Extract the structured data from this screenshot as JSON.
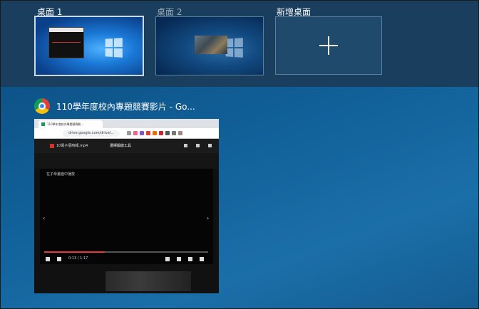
{
  "desktops": [
    {
      "label": "桌面 1",
      "active": true
    },
    {
      "label": "桌面 2",
      "active": false
    }
  ],
  "new_desktop": {
    "label": "新增桌面",
    "icon": "plus-icon"
  },
  "window": {
    "app_icon": "chrome-icon",
    "title": "110學年度校內專題競賽影片 - Go...",
    "thumbnail": {
      "tab_title": "110學年度校內專題競賽影...",
      "address": "drive.google.com/drive/...",
      "file_name": "10電子個時報.mp4",
      "open_with": "選擇開啟工具",
      "player_caption": "在子母畫面中播放",
      "time": "0:13 / 1:17",
      "progress": 0.37
    }
  },
  "colors": {
    "strip_bg": "#1a3f5e",
    "wallpaper": "#0f5a8c",
    "active_border": "#c9d9e8"
  }
}
